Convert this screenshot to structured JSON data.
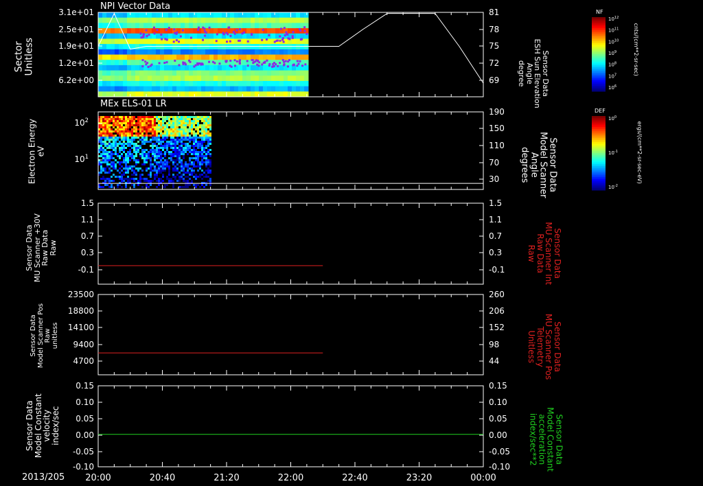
{
  "date_label": "2013/205",
  "colors": {
    "red": "#e02020",
    "green": "#20d020",
    "white": "#ffffff"
  },
  "chart_data": [
    {
      "type": "heatmap",
      "title": "NPI Vector Data",
      "ylabel": "Sector\nUnitless",
      "y_ticks": [
        "3.1e+01",
        "2.5e+01",
        "1.9e+01",
        "1.2e+01",
        "6.2e+00"
      ],
      "right_label": "Sensor Data\nESH Sun Elevation\nAngle\ndegree",
      "right_ticks": [
        "81",
        "78",
        "75",
        "72",
        "69"
      ],
      "data_end_time": "22:10",
      "line_series": {
        "name": "ESH Sun Elevation Angle",
        "x": [
          "20:00",
          "20:10",
          "20:20",
          "20:30",
          "21:00",
          "22:00",
          "22:30",
          "22:45",
          "23:00",
          "23:30",
          "23:45",
          "24:00"
        ],
        "y": [
          75,
          80.8,
          74.5,
          75,
          75,
          75,
          75,
          78,
          80.8,
          80.8,
          75,
          68.5
        ]
      },
      "colorbar": {
        "name": "NF",
        "units": "cnts/(cm**2-sr-sec)",
        "ticks": [
          "10^12",
          "10^11",
          "10^10",
          "10^9",
          "10^8",
          "10^7",
          "10^6"
        ]
      }
    },
    {
      "type": "heatmap",
      "title": "MEx ELS-01 LR",
      "ylabel": "Electron Energy\neV",
      "y_ticks": [
        "10^2",
        "10^1"
      ],
      "right_label": "Sensor Data\nModel Scanner\nAngle\ndegrees",
      "right_ticks": [
        "190",
        "150",
        "110",
        "70",
        "30"
      ],
      "data_end_time": "21:10",
      "line_series": {
        "name": "Model Scanner Angle",
        "x": [
          "20:00",
          "24:00"
        ],
        "y": [
          20,
          20
        ]
      },
      "colorbar": {
        "name": "DEF",
        "units": "ergs/(cm**2-sr-sec-eV)",
        "ticks": [
          "10^0",
          "10^-1",
          "10^-2"
        ]
      }
    },
    {
      "type": "line",
      "ylabel": "Sensor Data\nMU Scanner +30V\nRaw Data\nRaw",
      "y_ticks": [
        "1.5",
        "1.1",
        "0.7",
        "0.3",
        "-0.1"
      ],
      "right_label": "Sensor Data\nMU Scanner Int\nRaw Data\nRaw",
      "right_ticks": [
        "1.5",
        "1.1",
        "0.7",
        "0.3",
        "-0.1"
      ],
      "series": [
        {
          "x": [
            "20:00",
            "22:20"
          ],
          "y": [
            0.0,
            0.0
          ]
        }
      ]
    },
    {
      "type": "line",
      "ylabel": "Sensor Data\nModel Scanner Pos\nRaw\nunitless",
      "y_ticks": [
        "23500",
        "18800",
        "14100",
        "9400",
        "4700"
      ],
      "right_label": "Sensor Data\nMU Scanner Pos\nTelemetry\nUnitless",
      "right_ticks": [
        "260",
        "206",
        "152",
        "98",
        "44"
      ],
      "series": [
        {
          "x": [
            "20:00",
            "22:20"
          ],
          "y": [
            7000,
            7000
          ]
        }
      ]
    },
    {
      "type": "line",
      "ylabel": "Sensor Data\nModel Constant\nvelocity\nindex/sec",
      "y_ticks": [
        "0.15",
        "0.10",
        "0.05",
        "0.00",
        "-0.05",
        "-0.10"
      ],
      "right_label": "Sensor Data\nModel Constant\nacceleration\nindex/sec**2",
      "right_ticks": [
        "0.15",
        "0.10",
        "0.05",
        "0.00",
        "-0.05",
        "-0.10"
      ],
      "series": [
        {
          "x": [
            "20:00",
            "24:00"
          ],
          "y": [
            0.0,
            0.0
          ]
        }
      ]
    }
  ],
  "x_axis": {
    "ticks": [
      "20:00",
      "20:40",
      "21:20",
      "22:00",
      "22:40",
      "23:20",
      "00:00"
    ]
  }
}
